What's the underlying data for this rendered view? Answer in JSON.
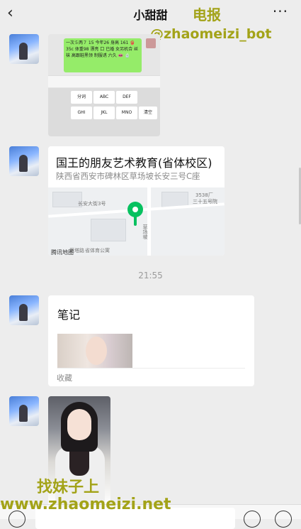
{
  "header": {
    "back_icon": "chevron-left-icon",
    "title": "小甜甜",
    "more_icon": "more-icon",
    "more_glyph": "···"
  },
  "watermarks": {
    "top_right_1": "电报",
    "top_right_2": "@zhaomeizi_bot",
    "bottom_1": "找妹子上",
    "bottom_2": "www.zhaomeizi.net"
  },
  "messages": [
    {
      "type": "image",
      "content": "chat-and-keyboard-screenshot",
      "green_bubble_text": "一次５两７ 15 今年26 身高 161 👙 35c 体重98 漂亮 口 已婚 女另机合 丝袜 高跟鞋黑领 制服诱 六久 👄 🍵",
      "keys": [
        "分词",
        "ABC",
        "DEF",
        "GHI",
        "JKL",
        "MNO",
        "清空"
      ]
    },
    {
      "type": "location",
      "name": "国王的朋友艺术教育(省体校区)",
      "address": "陕西省西安市碑林区草场坡长安三号C座",
      "map_labels": {
        "road": "长安大街3号",
        "building_1": "3538厂",
        "building_2": "三十五号院",
        "side_road": "草场坡",
        "bottom_1": "雁塔路",
        "bottom_2": "省体育公寓",
        "provider": "腾讯地图"
      }
    },
    {
      "type": "time",
      "text": "21:55"
    },
    {
      "type": "note",
      "title": "笔记",
      "tag": "收藏"
    },
    {
      "type": "photo"
    }
  ],
  "colors": {
    "background": "#ededed",
    "bubble_green": "#95ec69",
    "pin_green": "#07c160",
    "watermark": "#a3a318"
  }
}
